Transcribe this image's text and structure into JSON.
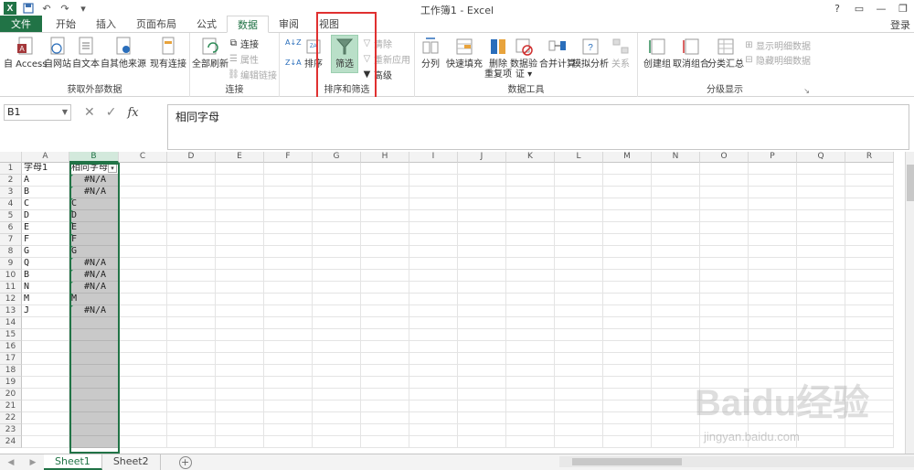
{
  "window": {
    "title": "工作簿1 - Excel",
    "login": "登录",
    "help": "?",
    "minimize": "—",
    "restore": "❐",
    "ribbon_opts": "▭"
  },
  "tabs": [
    {
      "label": "文件"
    },
    {
      "label": "开始"
    },
    {
      "label": "插入"
    },
    {
      "label": "页面布局"
    },
    {
      "label": "公式"
    },
    {
      "label": "数据"
    },
    {
      "label": "审阅"
    },
    {
      "label": "视图"
    }
  ],
  "ribbon": {
    "get_external": {
      "label": "获取外部数据",
      "access": "自 Access",
      "web": "自网站",
      "text": "自文本",
      "other": "自其他来源",
      "existing": "现有连接"
    },
    "connections": {
      "label": "连接",
      "refresh_all": "全部刷新",
      "connect": "连接",
      "properties": "属性",
      "edit_links": "编辑链接"
    },
    "sort_filter": {
      "label": "排序和筛选",
      "sort": "排序",
      "filter": "筛选",
      "clear": "清除",
      "reapply": "重新应用",
      "advanced": "高级"
    },
    "data_tools": {
      "label": "数据工具",
      "text_to_cols": "分列",
      "flash_fill": "快速填充",
      "remove_dup_1": "删除",
      "remove_dup_2": "重复项",
      "validation_1": "数据验",
      "validation_2": "证 ▾",
      "consolidate": "合并计算",
      "what_if": "模拟分析",
      "relationships": "关系"
    },
    "outline": {
      "label": "分级显示",
      "group": "创建组",
      "ungroup": "取消组合",
      "subtotal": "分类汇总",
      "show_detail": "显示明细数据",
      "hide_detail": "隐藏明细数据"
    }
  },
  "formula_bar": {
    "name_box": "B1",
    "cancel": "✕",
    "enter": "✓",
    "fx": "fx",
    "content": "相同字母"
  },
  "columns": [
    "A",
    "B",
    "C",
    "D",
    "E",
    "F",
    "G",
    "H",
    "I",
    "J",
    "K",
    "L",
    "M",
    "N",
    "O",
    "P",
    "Q",
    "R"
  ],
  "rows": [
    "1",
    "2",
    "3",
    "4",
    "5",
    "6",
    "7",
    "8",
    "9",
    "10",
    "11",
    "12",
    "13",
    "14",
    "15",
    "16",
    "17",
    "18",
    "19",
    "20",
    "21",
    "22",
    "23",
    "24"
  ],
  "cells": {
    "a": [
      "字母1",
      "A",
      "B",
      "C",
      "D",
      "E",
      "F",
      "G",
      "Q",
      "B",
      "N",
      "M",
      "J"
    ],
    "b": [
      "相同字母",
      "#N/A",
      "#N/A",
      "C",
      "D",
      "E",
      "F",
      "G",
      "#N/A",
      "#N/A",
      "#N/A",
      "M",
      "#N/A"
    ]
  },
  "sheets": {
    "s1": "Sheet1",
    "s2": "Sheet2",
    "add": "+",
    "prev": "◀",
    "next": "▶"
  },
  "watermark": {
    "brand": "Baidu经验",
    "url": "jingyan.baidu.com"
  }
}
